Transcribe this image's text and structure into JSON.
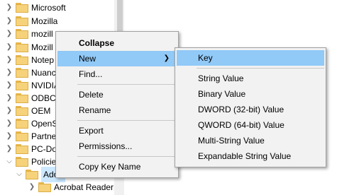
{
  "tree": {
    "items": [
      {
        "label": "Microsoft"
      },
      {
        "label": "Mozilla"
      },
      {
        "label": "mozill"
      },
      {
        "label": "Mozill"
      },
      {
        "label": "Notep"
      },
      {
        "label": "Nuanc"
      },
      {
        "label": "NVIDIA"
      },
      {
        "label": "ODBC"
      },
      {
        "label": "OEM"
      },
      {
        "label": "OpenS"
      },
      {
        "label": "Partne"
      },
      {
        "label": "PC-Do"
      },
      {
        "label": "Policie"
      },
      {
        "label": "Adob"
      },
      {
        "label": "Acrobat Reader"
      }
    ]
  },
  "context_menu": {
    "collapse": "Collapse",
    "new": "New",
    "find": "Find...",
    "delete": "Delete",
    "rename": "Rename",
    "export": "Export",
    "permissions": "Permissions...",
    "copy_key_name": "Copy Key Name"
  },
  "submenu": {
    "key": "Key",
    "string_value": "String Value",
    "binary_value": "Binary Value",
    "dword_value": "DWORD (32-bit) Value",
    "qword_value": "QWORD (64-bit) Value",
    "multi_string_value": "Multi-String Value",
    "expandable_string_value": "Expandable String Value"
  },
  "colors": {
    "menu_bg": "#f2f2f2",
    "highlight": "#91c9f7",
    "folder": "#f6d27a"
  },
  "icons": [
    "chevron-right-icon",
    "chevron-down-icon",
    "folder-icon",
    "submenu-arrow-icon"
  ]
}
